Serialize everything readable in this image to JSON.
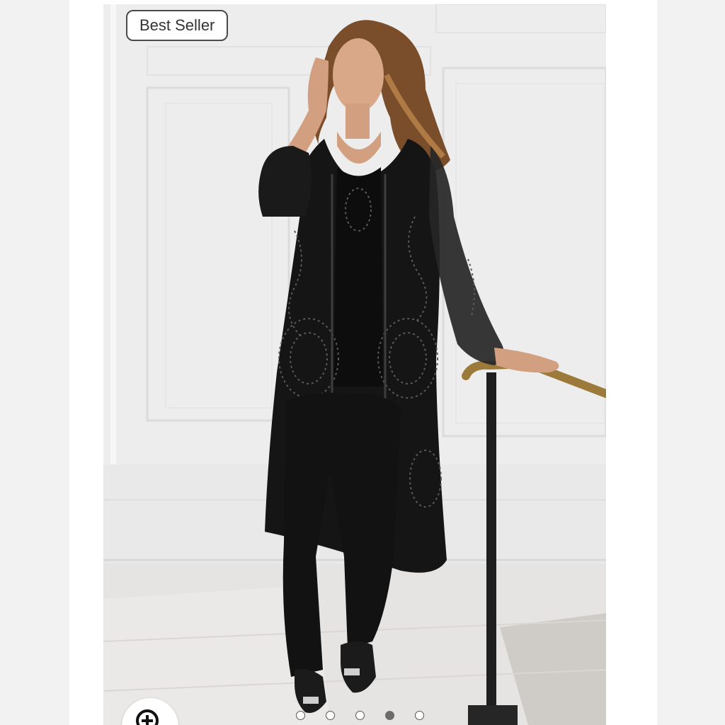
{
  "badge": {
    "label": "Best Seller"
  },
  "carousel": {
    "count": 5,
    "active_index": 3
  },
  "zoom": {
    "icon": "zoom-in-icon"
  },
  "colors": {
    "badge_border": "#4a4a4a",
    "dot_active": "#6b6b6b",
    "dot_inactive": "#ffffff"
  }
}
